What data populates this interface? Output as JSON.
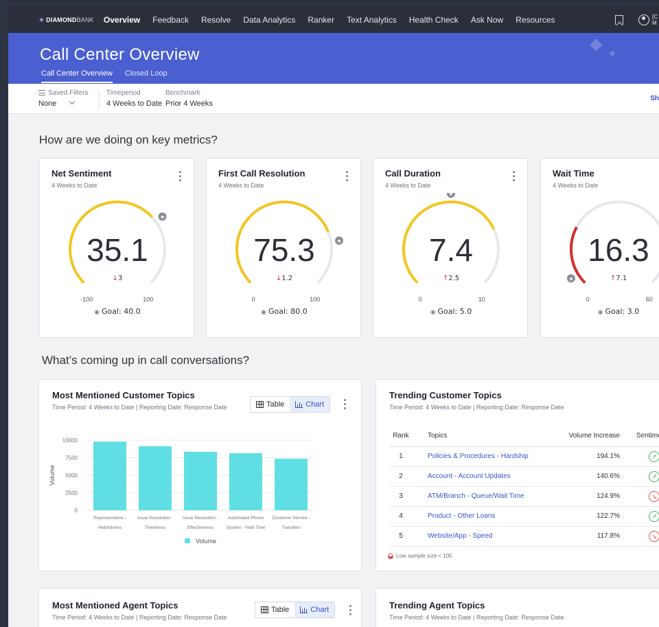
{
  "nav": {
    "logo_bold": "DIAMOND",
    "logo_light": "BANK",
    "items": [
      "Overview",
      "Feedback",
      "Resolve",
      "Data Analytics",
      "Ranker",
      "Text Analytics",
      "Health Check",
      "Ask Now",
      "Resources"
    ],
    "active": "Overview",
    "user_line1": "[C",
    "user_line2": "M"
  },
  "header": {
    "title": "Call Center Overview",
    "tabs": [
      "Call Center Overview",
      "Closed Loop"
    ]
  },
  "filters": {
    "saved_filters_label": "Saved Filters",
    "saved_filters_value": "None",
    "timeperiod_label": "Timeperiod",
    "timeperiod_value": "4 Weeks to Date",
    "benchmark_label": "Benchmark",
    "benchmark_value": "Prior 4 Weeks",
    "show_link": "Sh"
  },
  "sections": {
    "metrics": "How are we doing on key metrics?",
    "conversations": "What’s coming up in call conversations?"
  },
  "metrics": [
    {
      "title": "Net Sentiment",
      "period": "4 Weeks to Date",
      "value": "35.1",
      "change": "3",
      "direction": "down",
      "min": "-100",
      "max": "100",
      "goal": "Goal: 40.0",
      "fill_fraction": 0.675,
      "goal_fraction": 0.7,
      "color": "#f2c623"
    },
    {
      "title": "First Call Resolution",
      "period": "4 Weeks to Date",
      "value": "75.3",
      "change": "1.2",
      "direction": "down",
      "min": "0",
      "max": "100",
      "goal": "Goal: 80.0",
      "fill_fraction": 0.753,
      "goal_fraction": 0.8,
      "color": "#f2c623"
    },
    {
      "title": "Call Duration",
      "period": "4 Weeks to Date",
      "value": "7.4",
      "change": "2.5",
      "direction": "up",
      "min": "0",
      "max": "10",
      "goal": "Goal: 5.0",
      "fill_fraction": 0.74,
      "goal_fraction": 0.5,
      "color": "#f2c623"
    },
    {
      "title": "Wait Time",
      "period": "4 Weeks to Date",
      "value": "16.3",
      "change": "7.1",
      "direction": "up",
      "min": "0",
      "max": "60",
      "goal": "Goal: 3.0",
      "fill_fraction": 0.27,
      "goal_fraction": 0.05,
      "color": "#d62d2d"
    }
  ],
  "customer_topics": {
    "title": "Most Mentioned Customer Topics",
    "subtitle": "Time Period: 4 Weeks to Date | Reporting Date: Response Date",
    "table_label": "Table",
    "chart_label": "Chart"
  },
  "chart_data": {
    "type": "bar",
    "categories": [
      [
        "Representative -",
        "Helpfulness"
      ],
      [
        "Issue Resolution -",
        "Timeliness"
      ],
      [
        "Issue Resolution -",
        "Effectiveness"
      ],
      [
        "Automated Phone",
        "System - Hold Time"
      ],
      [
        "Customer Service -",
        "Transfers"
      ]
    ],
    "series": [
      {
        "name": "Volume",
        "values": [
          9800,
          9150,
          8350,
          8150,
          7350
        ]
      }
    ],
    "ylabel": "Volume",
    "yticks": [
      "0",
      "2500",
      "5000",
      "7500",
      "10000"
    ],
    "ylim": [
      0,
      10000
    ],
    "legend": "bottom",
    "color": "#5fdfe3"
  },
  "trending_customer": {
    "title": "Trending Customer Topics",
    "subtitle": "Time Period: 4 Weeks to Date | Reporting Date: Response Date",
    "headers": [
      "Rank",
      "Topics",
      "Volume Increase",
      "Sentimer"
    ],
    "rows": [
      {
        "rank": "1",
        "topic": "Policies & Procedures - Hardship",
        "vol": "194.1%",
        "sent": "up"
      },
      {
        "rank": "2",
        "topic": "Account - Account Updates",
        "vol": "140.6%",
        "sent": "up"
      },
      {
        "rank": "3",
        "topic": "ATM/Branch - Queue/Wait Time",
        "vol": "124.9%",
        "sent": "down"
      },
      {
        "rank": "4",
        "topic": "Product - Other Loans",
        "vol": "122.7%",
        "sent": "up"
      },
      {
        "rank": "5",
        "topic": "Website/App - Speed",
        "vol": "117.8%",
        "sent": "down"
      }
    ],
    "footnote": "Low sample size < 100"
  },
  "agent_topics": {
    "title": "Most Mentioned Agent Topics",
    "subtitle": "Time Period: 4 Weeks to Date | Reporting Date: Response Date",
    "table_label": "Table",
    "chart_label": "Chart"
  },
  "trending_agent": {
    "title": "Trending Agent Topics",
    "subtitle": "Time Period: 4 Weeks to Date | Reporting Date: Response Date"
  }
}
